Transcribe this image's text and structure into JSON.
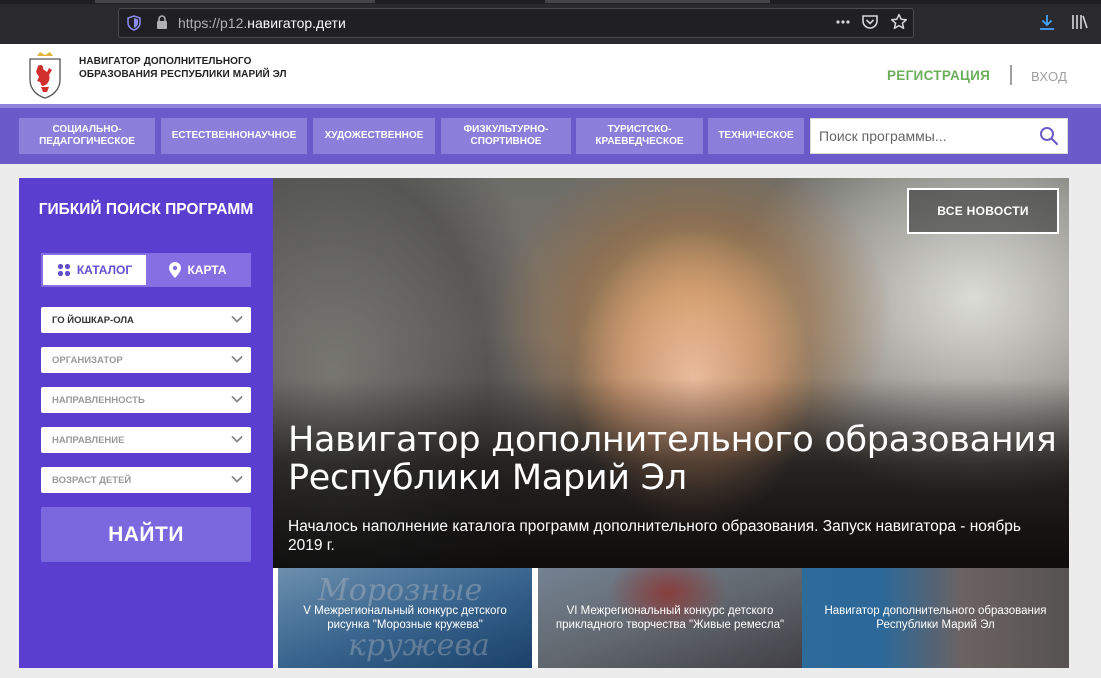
{
  "browser": {
    "url_prefix": "https://p12.",
    "url_domain": "навигатор.дети"
  },
  "header": {
    "title": "НАВИГАТОР ДОПОЛНИТЕЛЬНОГО ОБРАЗОВАНИЯ РЕСПУБЛИКИ МАРИЙ ЭЛ",
    "register": "РЕГИСТРАЦИЯ",
    "login": "ВХОД"
  },
  "nav": {
    "items": [
      "СОЦИАЛЬНО-ПЕДАГОГИЧЕСКОЕ",
      "ЕСТЕСТВЕННОНАУЧНОЕ",
      "ХУДОЖЕСТВЕННОЕ",
      "ФИЗКУЛЬТУРНО-СПОРТИВНОЕ",
      "ТУРИСТСКО-КРАЕВЕДЧЕСКОЕ",
      "ТЕХНИЧЕСКОЕ"
    ],
    "search_placeholder": "Поиск программы..."
  },
  "filter": {
    "title": "ГИБКИЙ ПОИСК ПРОГРАММ",
    "catalog": "КАТАЛОГ",
    "map": "КАРТА",
    "selects": [
      "ГО ЙОШКАР-ОЛА",
      "ОРГАНИЗАТОР",
      "НАПРАВЛЕННОСТЬ",
      "НАПРАВЛЕНИЕ",
      "ВОЗРАСТ ДЕТЕЙ"
    ],
    "find": "НАЙТИ"
  },
  "hero": {
    "all_news": "ВСЕ НОВОСТИ",
    "title": "Навигатор дополнительного образования Республики Марий Эл",
    "subtitle": "Началось наполнение каталога программ дополнительного образования. Запуск навигатора - ноябрь 2019 г."
  },
  "cards": [
    "V Межрегиональный конкурс детского рисунка \"Морозные кружева\"",
    "VI Межрегиональный конкурс детского прикладного творчества \"Живые ремесла\"",
    "Навигатор дополнительного образования Республики Марий Эл"
  ],
  "card_decor": {
    "line1": "Морозные",
    "line2": "кружева"
  },
  "colors": {
    "accent_purple": "#6b5bca",
    "panel_purple": "#5a3ed0",
    "register_green": "#6cae5a"
  },
  "icons": [
    "shield-icon",
    "lock-icon",
    "more-icon",
    "pocket-icon",
    "star-icon",
    "download-icon",
    "library-icon",
    "search-icon",
    "grid-icon",
    "map-pin-icon",
    "chevron-down-icon"
  ]
}
